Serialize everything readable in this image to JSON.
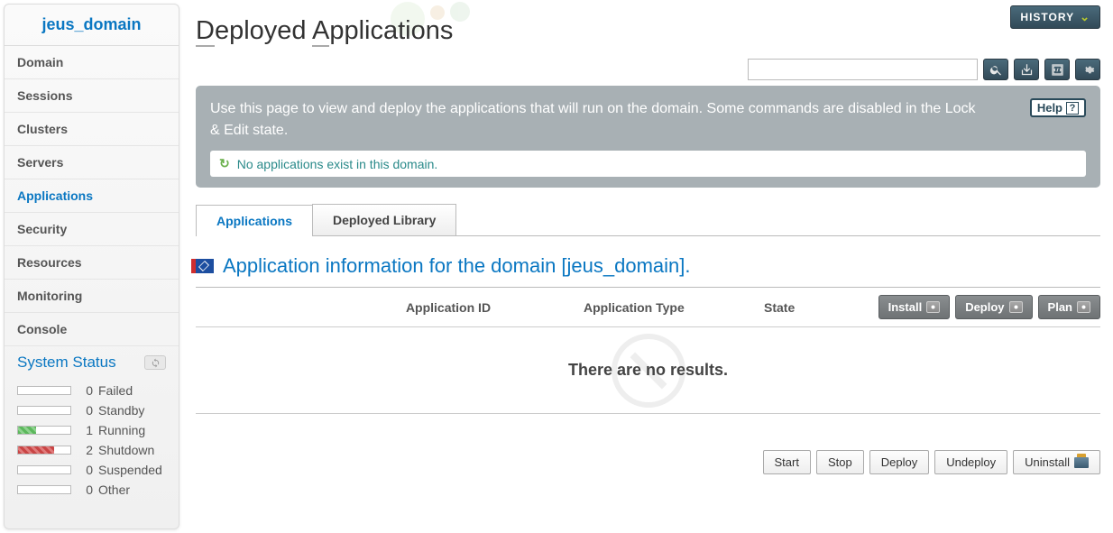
{
  "sidebar": {
    "title": "jeus_domain",
    "nav": [
      {
        "label": "Domain",
        "active": false
      },
      {
        "label": "Sessions",
        "active": false
      },
      {
        "label": "Clusters",
        "active": false
      },
      {
        "label": "Servers",
        "active": false
      },
      {
        "label": "Applications",
        "active": true
      },
      {
        "label": "Security",
        "active": false
      },
      {
        "label": "Resources",
        "active": false
      },
      {
        "label": "Monitoring",
        "active": false
      },
      {
        "label": "Console",
        "active": false
      }
    ],
    "status_header": "System Status",
    "status": [
      {
        "count": "0",
        "label": "Failed",
        "fill": ""
      },
      {
        "count": "0",
        "label": "Standby",
        "fill": ""
      },
      {
        "count": "1",
        "label": "Running",
        "fill": "green"
      },
      {
        "count": "2",
        "label": "Shutdown",
        "fill": "red"
      },
      {
        "count": "0",
        "label": "Suspended",
        "fill": ""
      },
      {
        "count": "0",
        "label": "Other",
        "fill": ""
      }
    ]
  },
  "header": {
    "history_label": "HISTORY",
    "page_title_parts": [
      "D",
      "eployed ",
      "A",
      "pplications"
    ]
  },
  "info": {
    "help_label": "Help",
    "description": "Use this page to view and deploy the applications that will run on the domain. Some commands are disabled in the Lock & Edit state.",
    "status_message": "No applications exist in this domain."
  },
  "tabs": [
    {
      "label": "Applications",
      "active": true
    },
    {
      "label": "Deployed Library",
      "active": false
    }
  ],
  "section": {
    "title": "Application information for the domain [jeus_domain]."
  },
  "table": {
    "columns": {
      "id": "Application ID",
      "type": "Application Type",
      "state": "State"
    },
    "actions": [
      {
        "label": "Install"
      },
      {
        "label": "Deploy"
      },
      {
        "label": "Plan"
      }
    ],
    "empty_message": "There are no results."
  },
  "footer_actions": [
    {
      "label": "Start"
    },
    {
      "label": "Stop"
    },
    {
      "label": "Deploy"
    },
    {
      "label": "Undeploy"
    },
    {
      "label": "Uninstall",
      "withIcon": true
    }
  ]
}
